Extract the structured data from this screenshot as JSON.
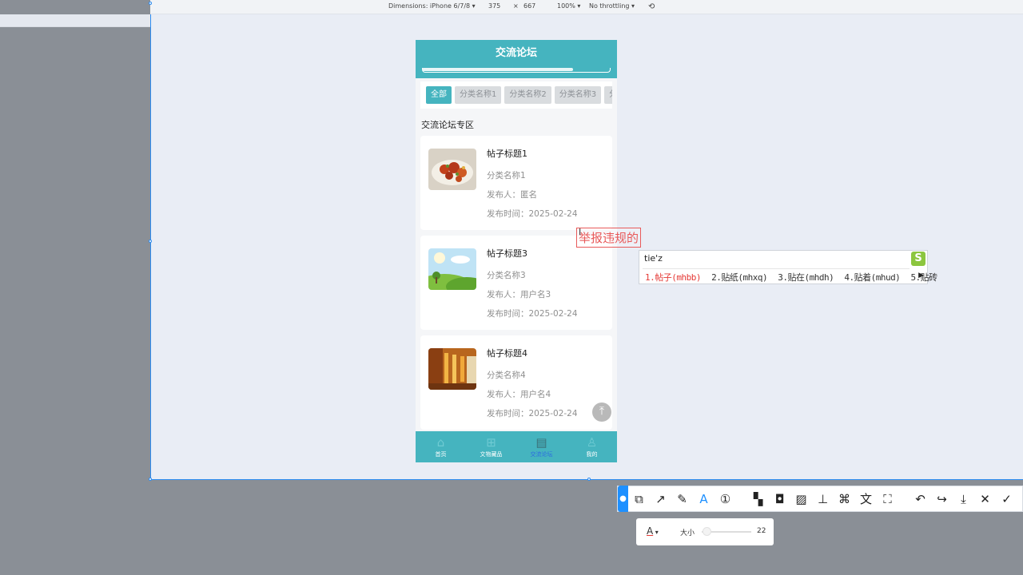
{
  "devtools": {
    "dimensions_label": "Dimensions: iPhone 6/7/8 ▾",
    "width": "375",
    "times": "×",
    "height": "667",
    "zoom": "100% ▾",
    "throttle": "No throttling ▾"
  },
  "app": {
    "title": "交流论坛",
    "progress": 0.8,
    "categories": [
      "全部",
      "分类名称1",
      "分类名称2",
      "分类名称3",
      "分"
    ],
    "section_title": "交流论坛专区",
    "posts": [
      {
        "title": "帖子标题1",
        "category": "分类名称1",
        "author": "发布人：匿名",
        "time": "发布时间：2025-02-24"
      },
      {
        "title": "帖子标题3",
        "category": "分类名称3",
        "author": "发布人：用户名3",
        "time": "发布时间：2025-02-24"
      },
      {
        "title": "帖子标题4",
        "category": "分类名称4",
        "author": "发布人：用户名4",
        "time": "发布时间：2025-02-24"
      }
    ],
    "tabs": [
      {
        "label": "首页",
        "icon": "home-icon"
      },
      {
        "label": "文物藏品",
        "icon": "grid-icon"
      },
      {
        "label": "交流论坛",
        "icon": "chat-icon"
      },
      {
        "label": "我的",
        "icon": "user-icon"
      }
    ],
    "accent_color": "#45b4bf"
  },
  "annotation": {
    "text": "举报违规的"
  },
  "ime": {
    "input": "tie'z",
    "candidates": [
      "1.帖子(mhbb)",
      "2.贴纸(mhxq)",
      "3.贴在(mhdh)",
      "4.贴着(mhud)",
      "5.贴砖"
    ]
  },
  "text_options": {
    "font_glyph": "A",
    "size_label": "大小",
    "size_value": "22",
    "size_level": 0.05
  }
}
